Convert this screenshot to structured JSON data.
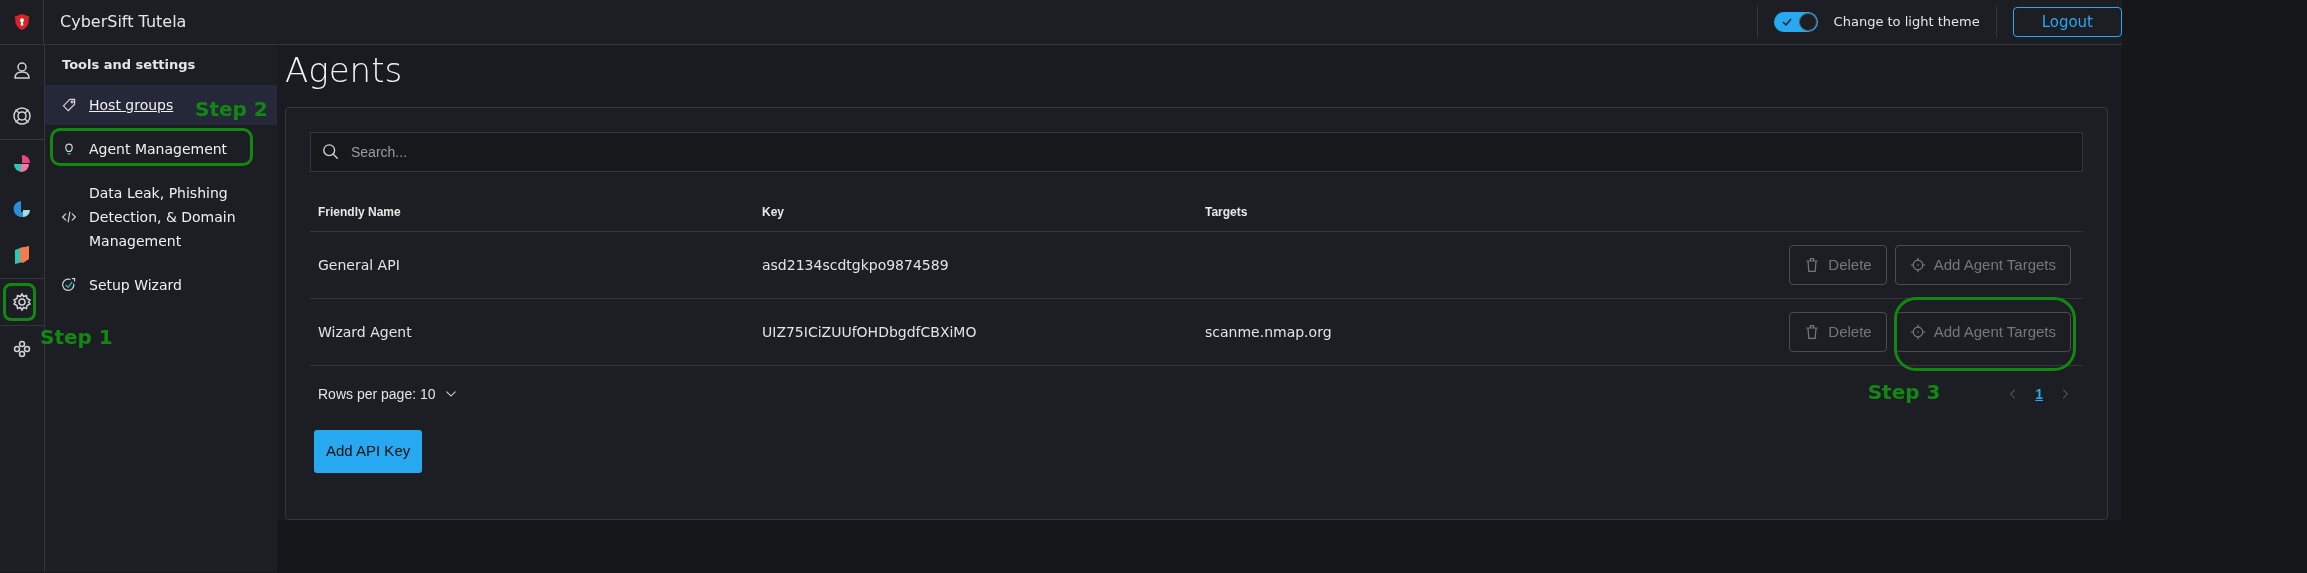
{
  "app": {
    "title": "CyberSift Tutela"
  },
  "theme_toggle": {
    "label": "Change to light theme",
    "on": true
  },
  "logout_button": "Logout",
  "rail": [
    {
      "items": [
        {
          "kind": "user",
          "highlighted": false
        },
        {
          "kind": "lifebuoy",
          "highlighted": false
        }
      ]
    },
    {
      "items": [
        {
          "kind": "pie",
          "highlighted": false
        },
        {
          "kind": "drop",
          "highlighted": false
        },
        {
          "kind": "shield",
          "highlighted": false
        }
      ]
    },
    {
      "items": [
        {
          "kind": "gear",
          "highlighted": true,
          "annotation": "Step 1"
        }
      ]
    },
    {
      "items": [
        {
          "kind": "group",
          "highlighted": false
        }
      ]
    }
  ],
  "tools_menu": {
    "title": "Tools and settings",
    "items": [
      {
        "label": "Host groups",
        "kind": "tag",
        "selected": true,
        "highlighted": false
      },
      {
        "label": "Agent Management",
        "kind": "bulb",
        "selected": false,
        "highlighted": true,
        "annotation": "Step 2"
      },
      {
        "label": "Data Leak, Phishing Detection, & Domain Management",
        "kind": "code",
        "selected": false,
        "highlighted": false
      },
      {
        "label": "Setup Wizard",
        "kind": "wizard",
        "selected": false,
        "highlighted": false
      }
    ]
  },
  "page_title": "Agents",
  "search": {
    "placeholder": "Search..."
  },
  "table": {
    "columns": [
      "Friendly Name",
      "Key",
      "Targets"
    ],
    "rows": [
      {
        "name": "General API",
        "key": "asd2134scdtgkpo9874589",
        "actions": [
          {
            "kind": "delete",
            "label": "Delete",
            "disabled": true,
            "highlighted": false
          },
          {
            "kind": "targets",
            "label": "Add Agent Targets",
            "disabled": true,
            "highlighted": false
          }
        ]
      },
      {
        "name": "Wizard Agent",
        "key": "UIZ75ICiZUUfOHDbgdfCBXiMO",
        "targets": "scanme.nmap.org",
        "actions": [
          {
            "kind": "delete",
            "label": "Delete",
            "disabled": true,
            "highlighted": false
          },
          {
            "kind": "targets",
            "label": "Add Agent Targets",
            "disabled": true,
            "highlighted": true,
            "annotation": "Step 3"
          }
        ]
      }
    ]
  },
  "pagination": {
    "rows_per_page": "Rows per page: 10",
    "pages": [
      {
        "label": "1",
        "selected": true
      }
    ]
  },
  "add_button": "Add API Key"
}
